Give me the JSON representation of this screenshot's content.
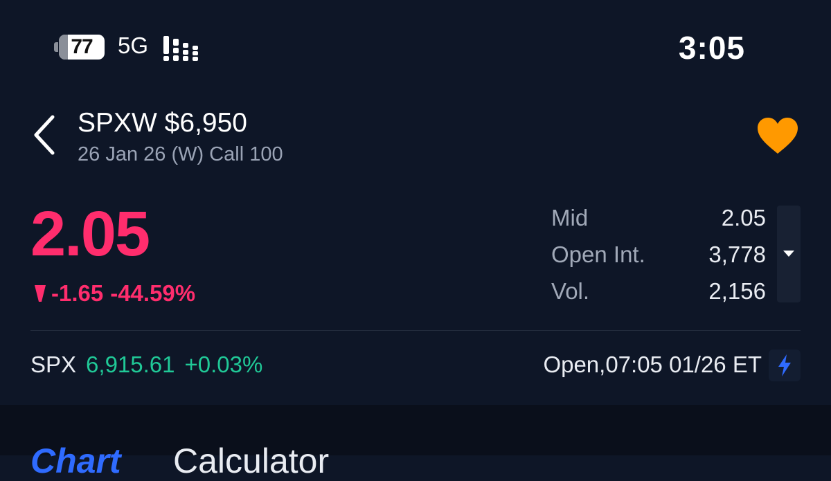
{
  "status_bar": {
    "battery_level": "77",
    "network": "5G",
    "time": "3:05"
  },
  "header": {
    "title": "SPXW $6,950",
    "subtitle": "26 Jan 26 (W) Call 100",
    "back_icon": "chevron-left-icon",
    "favorite_icon": "heart-icon"
  },
  "quote": {
    "price": "2.05",
    "change": "-1.65",
    "change_pct": "-44.59%",
    "direction_icon": "down-triangle-icon"
  },
  "stats": [
    {
      "label": "Mid",
      "value": "2.05"
    },
    {
      "label": "Open Int.",
      "value": "3,778"
    },
    {
      "label": "Vol.",
      "value": "2,156"
    }
  ],
  "underlying": {
    "symbol": "SPX",
    "price": "6,915.61",
    "change_pct": "+0.03%"
  },
  "session": {
    "text": "Open,07:05 01/26 ET",
    "icon": "lightning-icon"
  },
  "tabs": {
    "chart": "Chart",
    "calculator": "Calculator"
  },
  "colors": {
    "background": "#0e1627",
    "negative": "#ff2d6d",
    "positive": "#20c997",
    "favorite": "#ff9900",
    "accent": "#2f6bff"
  }
}
